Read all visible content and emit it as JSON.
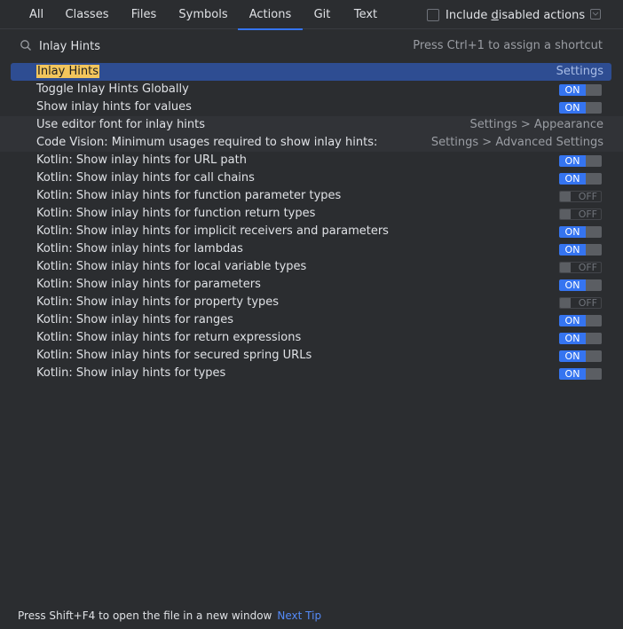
{
  "tabs": [
    "All",
    "Classes",
    "Files",
    "Symbols",
    "Actions",
    "Git",
    "Text"
  ],
  "active_tab": "Actions",
  "include_disabled": {
    "prefix": "Include ",
    "mnemonic": "d",
    "suffix": "isabled actions",
    "checked": false
  },
  "search": {
    "value": "Inlay Hints",
    "hint": "Press Ctrl+1 to assign a shortcut"
  },
  "results": [
    {
      "label": "Inlay Hints",
      "right": "Settings",
      "selected": true
    },
    {
      "label": "Toggle Inlay Hints Globally",
      "toggle": "ON"
    },
    {
      "label": "Show inlay hints for values",
      "toggle": "ON"
    },
    {
      "label": "Use editor font for inlay hints",
      "right": "Settings > Appearance"
    },
    {
      "label": "Code Vision: Minimum usages required to show inlay hints:",
      "right": "Settings > Advanced Settings"
    },
    {
      "label": "Kotlin: Show inlay hints for URL path",
      "toggle": "ON"
    },
    {
      "label": "Kotlin: Show inlay hints for call chains",
      "toggle": "ON"
    },
    {
      "label": "Kotlin: Show inlay hints for function parameter types",
      "toggle": "OFF"
    },
    {
      "label": "Kotlin: Show inlay hints for function return types",
      "toggle": "OFF"
    },
    {
      "label": "Kotlin: Show inlay hints for implicit receivers and parameters",
      "toggle": "ON"
    },
    {
      "label": "Kotlin: Show inlay hints for lambdas",
      "toggle": "ON"
    },
    {
      "label": "Kotlin: Show inlay hints for local variable types",
      "toggle": "OFF"
    },
    {
      "label": "Kotlin: Show inlay hints for parameters",
      "toggle": "ON"
    },
    {
      "label": "Kotlin: Show inlay hints for property types",
      "toggle": "OFF"
    },
    {
      "label": "Kotlin: Show inlay hints for ranges",
      "toggle": "ON"
    },
    {
      "label": "Kotlin: Show inlay hints for return expressions",
      "toggle": "ON"
    },
    {
      "label": "Kotlin: Show inlay hints for secured spring URLs",
      "toggle": "ON"
    },
    {
      "label": "Kotlin: Show inlay hints for types",
      "toggle": "ON"
    }
  ],
  "footer": {
    "text": "Press Shift+F4 to open the file in a new window",
    "link": "Next Tip"
  },
  "colors": {
    "accent": "#3574f0",
    "selection": "#2e4d92",
    "highlight": "#f2c55c",
    "background": "#2b2d30"
  }
}
